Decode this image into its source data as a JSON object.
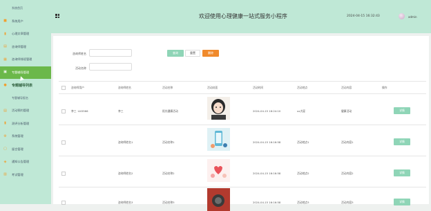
{
  "sidebar": {
    "items": [
      {
        "label": "系统首页",
        "icon": "",
        "state": "sub"
      },
      {
        "label": "系统用户",
        "icon": "user-icon",
        "color": "#f0a030"
      },
      {
        "label": "心理文章管理",
        "icon": "chart-icon",
        "color": "#f0a030"
      },
      {
        "label": "咨询师管理",
        "icon": "doc-icon",
        "color": "#f0a030"
      },
      {
        "label": "咨询师排班管理",
        "icon": "calendar-icon",
        "color": "#f0a030"
      },
      {
        "label": "专题辅导管理",
        "icon": "folder-icon",
        "color": "#f0a030",
        "state": "active"
      },
      {
        "label": "专题辅导列表",
        "icon": "pin-icon",
        "color": "#f0a030",
        "state": "parent"
      },
      {
        "label": "专题辅导报名",
        "icon": "",
        "state": "sub"
      },
      {
        "label": "活动预约管理",
        "icon": "doc-icon",
        "color": "#f0a030"
      },
      {
        "label": "测评分析管理",
        "icon": "chart-icon",
        "color": "#f0a030"
      },
      {
        "label": "系统管理",
        "icon": "gear-icon",
        "color": "#f0a030"
      },
      {
        "label": "留言管理",
        "icon": "message-icon",
        "color": "#f0a030"
      },
      {
        "label": "通知公告管理",
        "icon": "bell-icon",
        "color": "#f0a030"
      },
      {
        "label": "考试管理",
        "icon": "exam-icon",
        "color": "#f0a030"
      }
    ]
  },
  "header": {
    "title": "欢迎使用心理健康一站式服务小程序",
    "clock": "2024-04-15 16:32:43",
    "user": "admin"
  },
  "search": {
    "consultant_label": "咨询师姓名",
    "activity_label": "活动名称",
    "search_btn": "查询",
    "add_btn": "重置",
    "delete_btn": "删除"
  },
  "table": {
    "headers": [
      "咨询师用户",
      "咨询师姓名",
      "活动名称",
      "活动封面",
      "活动时间",
      "活动地点",
      "活动内容",
      "操作"
    ],
    "rows": [
      {
        "user": "李三 ·445566",
        "name": "李三",
        "activity": "阳光健康活动",
        "time": "2024-04-15 16:24:10",
        "place": "xx大厦",
        "content": "健康活动",
        "thumb": "girl"
      },
      {
        "user": "",
        "name": "咨询师姓名1",
        "activity": "活动名称1",
        "time": "2024-04-15 16:16:58",
        "place": "活动地点1",
        "content": "活动内容1",
        "thumb": "phone"
      },
      {
        "user": "",
        "name": "咨询师姓名2",
        "activity": "活动名称2",
        "time": "2024-04-15 16:16:58",
        "place": "活动地点2",
        "content": "活动内容2",
        "thumb": "hearts"
      },
      {
        "user": "",
        "name": "咨询师姓名3",
        "activity": "活动名称3",
        "time": "2024-04-15 16:16:58",
        "place": "活动地点3",
        "content": "活动内容3",
        "thumb": "red"
      }
    ],
    "detail_label": "详情"
  }
}
